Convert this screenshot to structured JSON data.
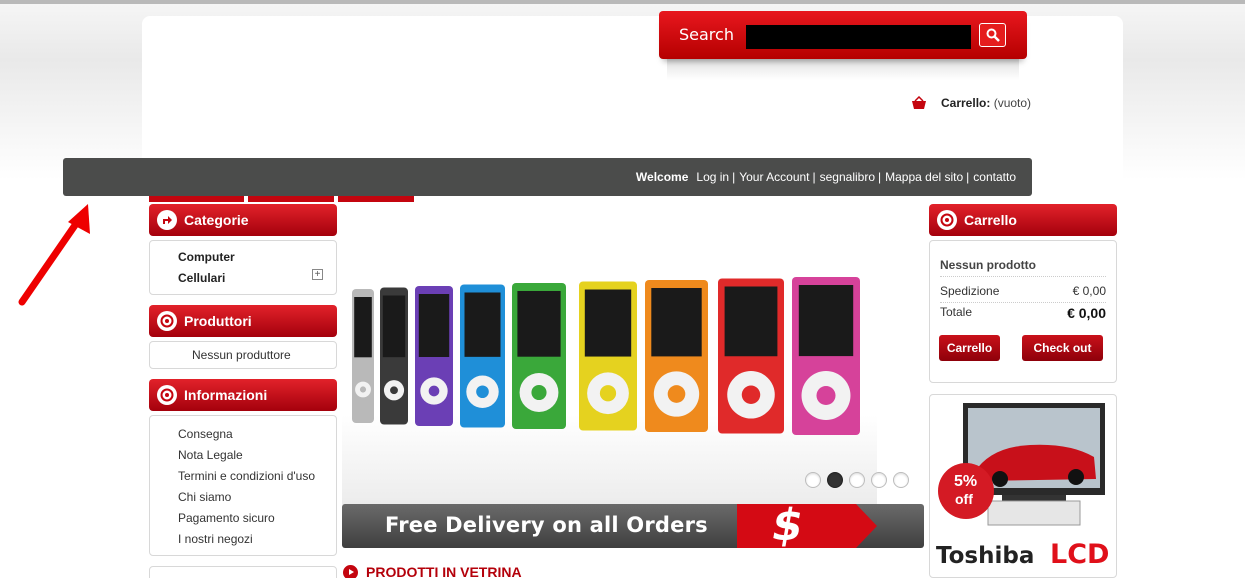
{
  "search": {
    "label": "Search",
    "placeholder": ""
  },
  "header_cart": {
    "label": "Carrello:",
    "value": "(vuoto)"
  },
  "welcome_bar": {
    "welcome": "Welcome",
    "links": [
      "Log in",
      "Your Account",
      "segnalibro",
      "Mappa del sito",
      "contatto"
    ],
    "separator": "|"
  },
  "categories": {
    "title": "Categorie",
    "items": [
      "Computer",
      "Cellulari"
    ],
    "expand_symbol": "+"
  },
  "manufacturers": {
    "title": "Produttori",
    "empty_text": "Nessun produttore"
  },
  "info": {
    "title": "Informazioni",
    "items": [
      "Consegna",
      "Nota Legale",
      "Termini e condizioni d'uso",
      "Chi siamo",
      "Pagamento sicuro",
      "I nostri negozi"
    ]
  },
  "slider": {
    "dots": 5,
    "active_dot": 2,
    "ipod_colors": [
      "#b9b9b9",
      "#3a3a3a",
      "#6b3fb5",
      "#1f8fd8",
      "#3aa83a",
      "#e5d21f",
      "#ef8a1d",
      "#e02a2a",
      "#d6429a"
    ]
  },
  "banner": {
    "text": "Free Delivery on all Orders",
    "symbol": "$"
  },
  "featured": {
    "title": "PRODOTTI IN VETRINA"
  },
  "cart_block": {
    "title": "Carrello",
    "no_product": "Nessun prodotto",
    "shipping_label": "Spedizione",
    "shipping_value": "€ 0,00",
    "total_label": "Totale",
    "total_value": "€ 0,00",
    "cart_button": "Carrello",
    "checkout_button": "Check out"
  },
  "ad": {
    "badge_big": "5%",
    "badge_small": "off",
    "brand": "Toshiba",
    "product": "LCD"
  },
  "colors": {
    "accent": "#c4050f",
    "bar": "#4b4c4b"
  }
}
